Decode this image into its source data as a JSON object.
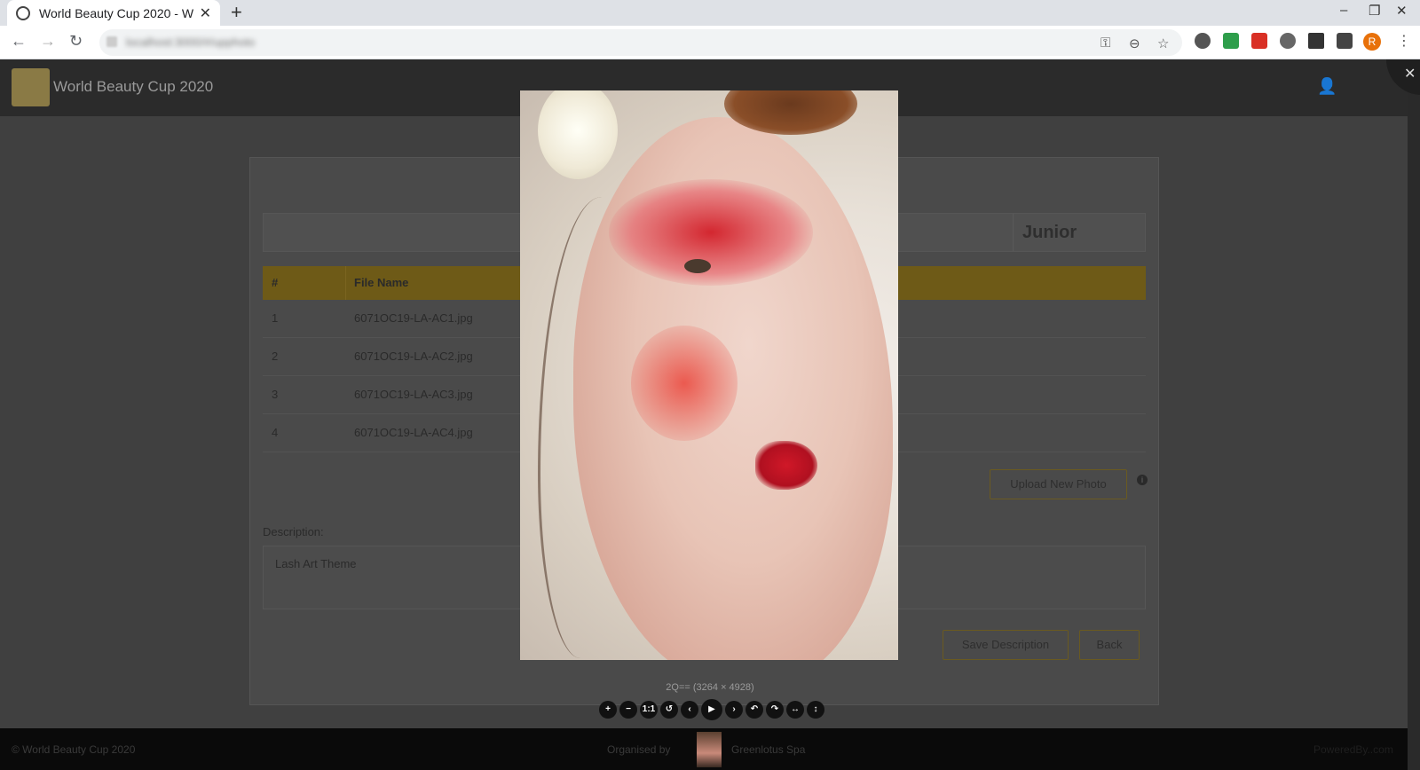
{
  "browser": {
    "tab_title": "World Beauty Cup 2020 - W",
    "url": "localhost:3000/#/upphoto"
  },
  "app": {
    "title": "World Beauty Cup 2020",
    "category": "Junior",
    "table": {
      "headers": [
        "#",
        "File Name"
      ],
      "rows": [
        {
          "num": "1",
          "file": "6071OC19-LA-AC1.jpg"
        },
        {
          "num": "2",
          "file": "6071OC19-LA-AC2.jpg"
        },
        {
          "num": "3",
          "file": "6071OC19-LA-AC3.jpg"
        },
        {
          "num": "4",
          "file": "6071OC19-LA-AC4.jpg"
        }
      ]
    },
    "upload_label": "Upload New Photo",
    "description_label": "Description:",
    "description_value": "Lash Art Theme",
    "save_label": "Save Description",
    "back_label": "Back",
    "footer": {
      "copyright": "© World Beauty Cup 2020",
      "organised_by": "Organised by",
      "organiser": "Greenlotus Spa",
      "powered": "PoweredBy..com"
    }
  },
  "viewer": {
    "caption": "2Q== (3264 × 4928)",
    "tools": [
      "zoom-in-icon",
      "zoom-out-icon",
      "one-to-one-icon",
      "reset-icon",
      "prev-icon",
      "play-icon",
      "next-icon",
      "rotate-left-icon",
      "rotate-right-icon",
      "flip-horizontal-icon",
      "flip-vertical-icon"
    ]
  }
}
